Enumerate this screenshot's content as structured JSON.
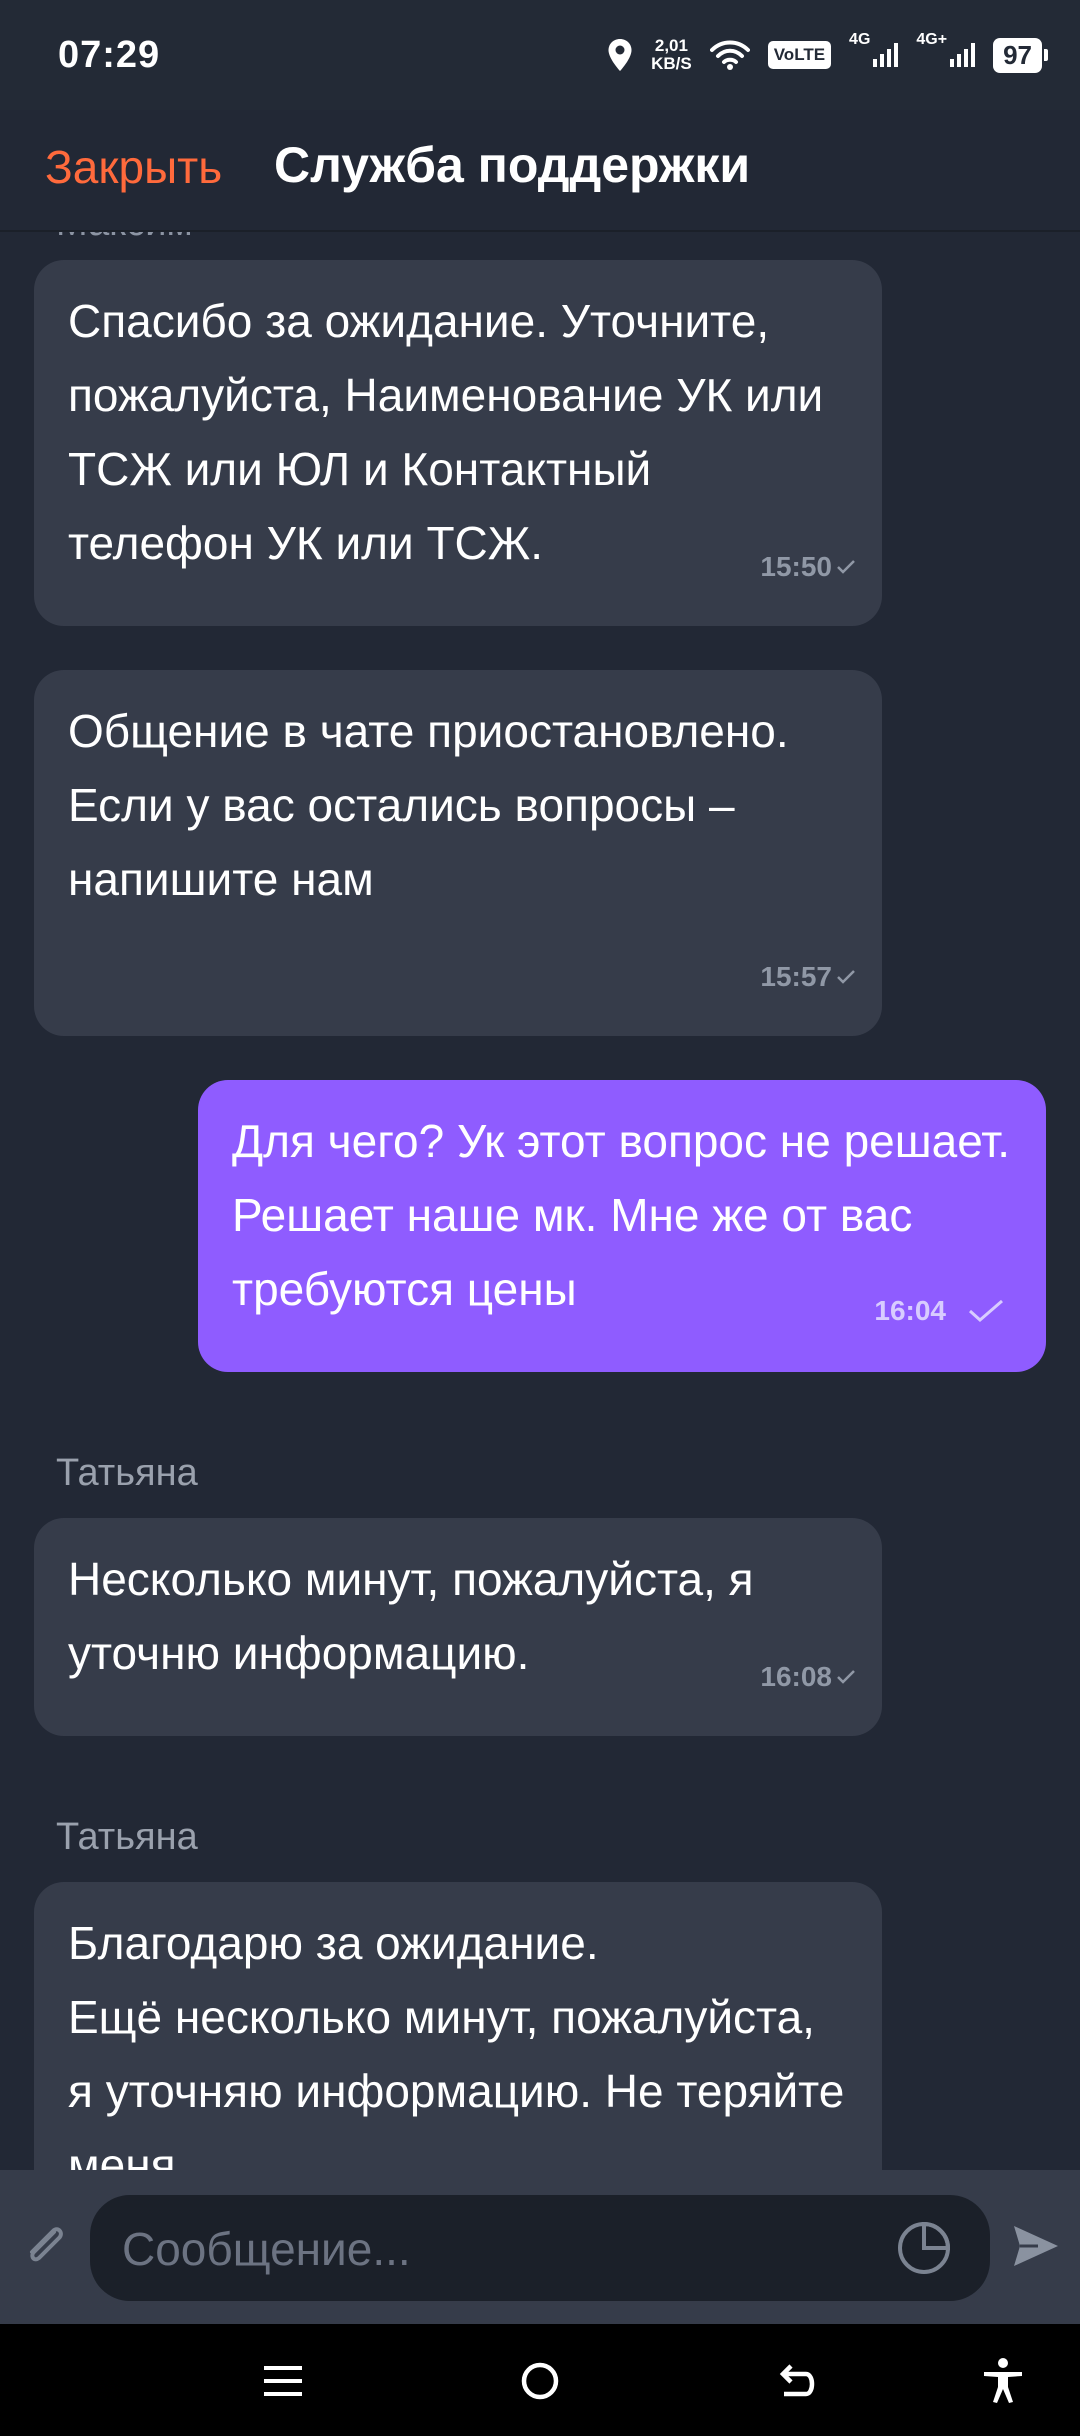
{
  "status_bar": {
    "time": "07:29",
    "speed_value": "2,01",
    "speed_unit": "KB/S",
    "volte": "VoLTE",
    "sim1": "4G",
    "sim2": "4G+",
    "battery": "97"
  },
  "header": {
    "close_label": "Закрыть",
    "title": "Служба поддержки"
  },
  "messages": [
    {
      "direction": "in",
      "sender": "",
      "text": "Спасибо за ожидание. Уточните, пожалуйста, Наименование УК или ТСЖ или ЮЛ и Контактный телефон УК или ТСЖ.",
      "time": "15:50"
    },
    {
      "direction": "in",
      "sender": "",
      "text": "Общение в чате приостановлено. Если у вас остались вопросы – напишите нам",
      "time": "15:57"
    },
    {
      "direction": "out",
      "sender": "",
      "text": "Для чего? Ук этот вопрос не решает. Решает наше мк. Мне же от вас требуются цены",
      "time": "16:04"
    },
    {
      "direction": "in",
      "sender": "Татьяна",
      "text": "Несколько минут, пожалуйста, я уточню информацию.",
      "time": "16:08"
    },
    {
      "direction": "in",
      "sender": "Татьяна",
      "text": "Благодарю за ожидание.\nЕщё несколько минут, пожалуйста, я уточняю информацию. Не теряйте меня.",
      "time": ""
    }
  ],
  "input": {
    "placeholder": "Сообщение..."
  },
  "icons": {
    "attach": "paperclip-icon",
    "sticker": "sticker-icon",
    "send": "send-icon",
    "location": "location-icon",
    "wifi": "wifi-icon"
  },
  "colors": {
    "background": "#222835",
    "incoming_bubble": "#363c4a",
    "outgoing_bubble": "#8f5cff",
    "close_accent": "#ff6a3c"
  }
}
